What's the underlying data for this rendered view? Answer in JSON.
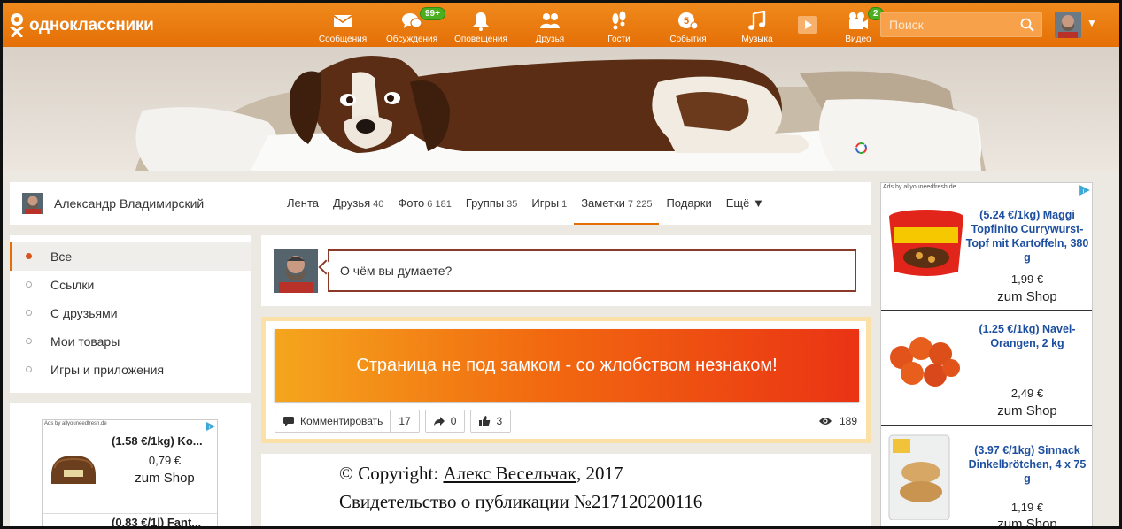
{
  "brand": {
    "logo_text": "одноклассники"
  },
  "nav": [
    {
      "label": "Сообщения",
      "icon": "envelope-icon"
    },
    {
      "label": "Обсуждения",
      "icon": "chat-bubbles-icon",
      "badge": "99+"
    },
    {
      "label": "Оповещения",
      "icon": "bell-icon"
    },
    {
      "label": "Друзья",
      "icon": "friends-icon"
    },
    {
      "label": "Гости",
      "icon": "footprints-icon"
    },
    {
      "label": "События",
      "icon": "events-icon",
      "badge": "5"
    },
    {
      "label": "Музыка",
      "icon": "music-note-icon"
    },
    {
      "label": "",
      "icon": "play-icon"
    },
    {
      "label": "Видео",
      "icon": "video-camera-icon",
      "badge": "2"
    }
  ],
  "search": {
    "placeholder": "Поиск"
  },
  "profile": {
    "name": "Александр Владимирский",
    "tabs": [
      {
        "label": "Лента",
        "count": ""
      },
      {
        "label": "Друзья",
        "count": "40"
      },
      {
        "label": "Фото",
        "count": "6 181"
      },
      {
        "label": "Группы",
        "count": "35"
      },
      {
        "label": "Игры",
        "count": "1"
      },
      {
        "label": "Заметки",
        "count": "7 225",
        "active": true
      },
      {
        "label": "Подарки",
        "count": ""
      },
      {
        "label": "Ещё ▼",
        "count": ""
      }
    ]
  },
  "left_menu": [
    {
      "label": "Все",
      "active": true
    },
    {
      "label": "Ссылки"
    },
    {
      "label": "С друзьями"
    },
    {
      "label": "Мои товары"
    },
    {
      "label": "Игры и приложения"
    }
  ],
  "left_ad": {
    "ads_by": "Ads by allyouneedfresh.de",
    "items": [
      {
        "title": "(1.58 €/1kg) Ko...",
        "price": "0,79 €",
        "shop": "zum Shop"
      },
      {
        "title": "(0.83 €/1l) Fant..."
      }
    ]
  },
  "composer": {
    "placeholder": "О чём вы думаете?"
  },
  "post": {
    "banner_text": "Страница не под замком - со жлобством незнаком!",
    "comment_label": "Комментировать",
    "comment_count": "17",
    "share_count": "0",
    "like_count": "3",
    "views": "189"
  },
  "copyright": {
    "prefix": "© Copyright: ",
    "author": "Алекс Весельчак",
    "year_suffix": ", 2017",
    "certificate": "Свидетельство о публикации №217120200116"
  },
  "right_ad": {
    "ads_by": "Ads by allyouneedfresh.de",
    "items": [
      {
        "title": "(5.24 €/1kg) Maggi Topfinito Currywurst-Topf mit Kartoffeln, 380 g",
        "price": "1,99 €",
        "shop": "zum Shop"
      },
      {
        "title": "(1.25 €/1kg) Navel-Orangen, 2 kg",
        "price": "2,49 €",
        "shop": "zum Shop"
      },
      {
        "title": "(3.97 €/1kg) Sinnack Dinkelbrötchen, 4 x 75 g",
        "price": "1,19 €",
        "shop": "zum Shop"
      }
    ]
  },
  "colors": {
    "brand_orange": "#e46f06",
    "badge_green": "#4caf22",
    "ad_title_blue": "#1d4fa0",
    "composer_border": "#8b3a2a"
  }
}
